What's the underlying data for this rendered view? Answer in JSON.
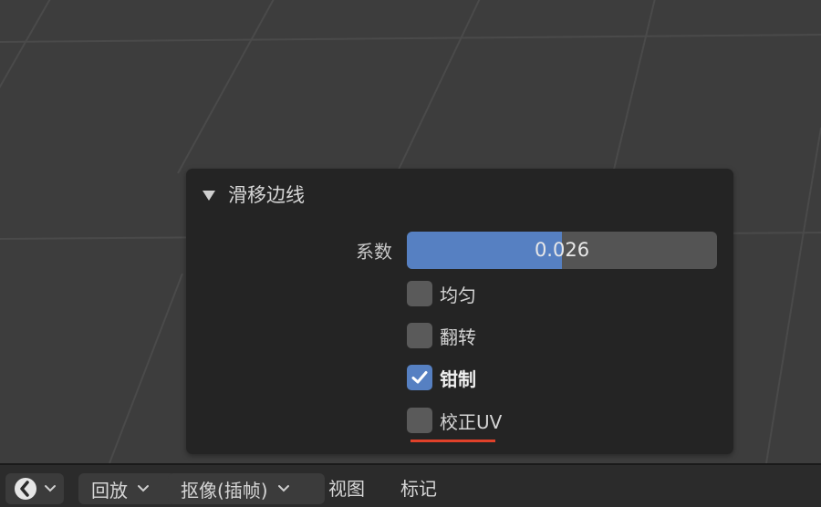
{
  "panel": {
    "title": "滑移边线",
    "factor": {
      "label": "系数",
      "value_text": "0.026",
      "fill_fraction": 0.5
    },
    "options": [
      {
        "label": "均匀",
        "checked": false
      },
      {
        "label": "翻转",
        "checked": false
      },
      {
        "label": "钳制",
        "checked": true
      },
      {
        "label": "校正UV",
        "checked": false
      }
    ]
  },
  "timeline_header": {
    "editor_icon": "clock-icon",
    "menus": [
      "回放",
      "抠像(插帧)",
      "视图",
      "标记"
    ]
  },
  "colors": {
    "accent": "#5680c2",
    "annotation": "#e0412a",
    "viewport_bg": "#3d3d3d",
    "panel_bg": "#242424"
  }
}
